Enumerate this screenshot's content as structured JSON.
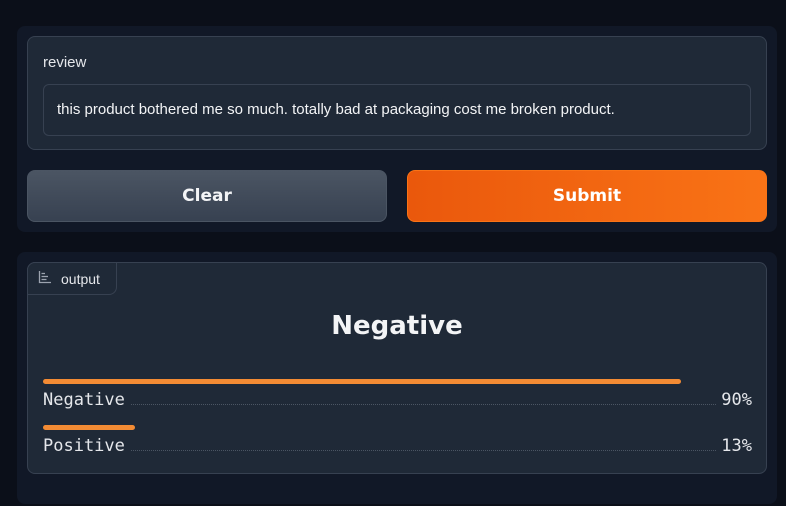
{
  "input": {
    "label": "review",
    "value": "this product bothered me so much. totally bad at packaging cost me broken product."
  },
  "buttons": {
    "clear_label": "Clear",
    "submit_label": "Submit"
  },
  "output": {
    "tag_label": "output",
    "tag_icon": "chart-icon",
    "predicted_label": "Negative",
    "accent_color": "#f38b34",
    "confidences": [
      {
        "label": "Negative",
        "value_text": "90%",
        "fraction": 0.9
      },
      {
        "label": "Positive",
        "value_text": "13%",
        "fraction": 0.13
      }
    ]
  }
}
